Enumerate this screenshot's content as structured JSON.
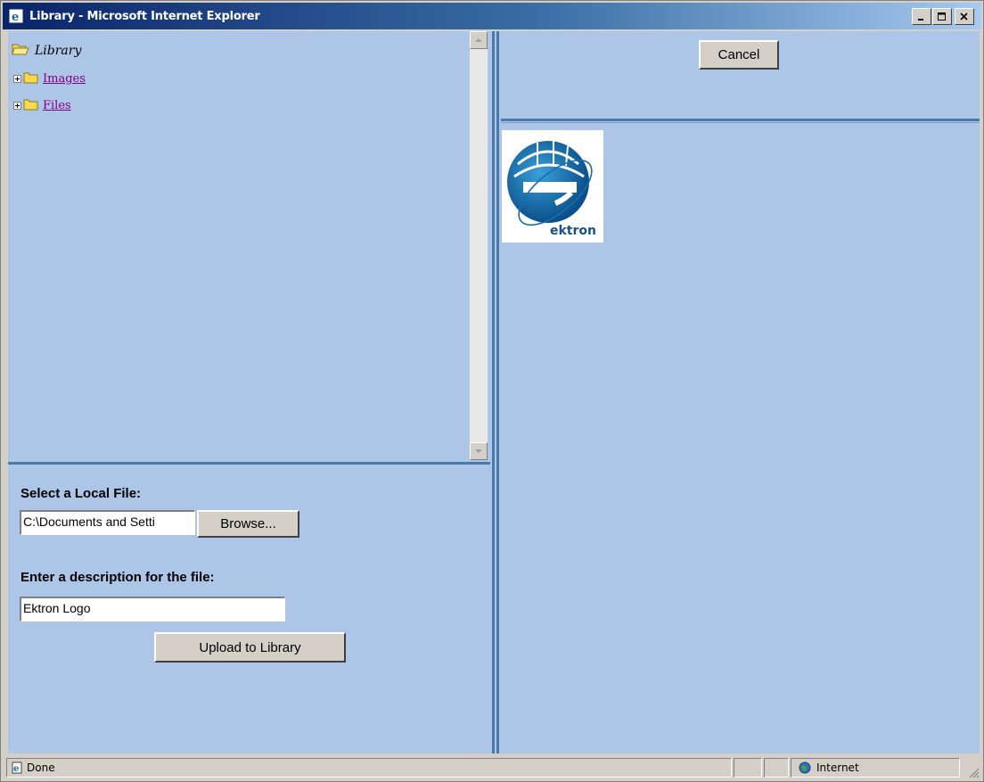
{
  "window": {
    "title": "Library - Microsoft Internet Explorer",
    "app_icon": "ie-icon",
    "controls": [
      "minimize",
      "maximize",
      "close"
    ]
  },
  "tree": {
    "root_label": "Library",
    "items": [
      {
        "label": "Images",
        "icon": "folder-icon",
        "expander": "plus"
      },
      {
        "label": "Files",
        "icon": "folder-icon",
        "expander": "plus"
      }
    ]
  },
  "upload": {
    "local_file_label": "Select a Local File:",
    "local_file_value": "C:\\Documents and Setti",
    "browse_label": "Browse...",
    "description_label": "Enter a description for the file:",
    "description_value": "Ektron Logo",
    "upload_label": "Upload to Library"
  },
  "right": {
    "cancel_label": "Cancel",
    "preview_image": {
      "name": "ektron-logo",
      "text": "ektron"
    }
  },
  "statusbar": {
    "status_text": "Done",
    "zone_text": "Internet"
  },
  "colors": {
    "frame_bg": "#adc5e7",
    "frame_border": "#4c7aa8",
    "chrome": "#d4d0c8",
    "link_visited": "#800080"
  }
}
